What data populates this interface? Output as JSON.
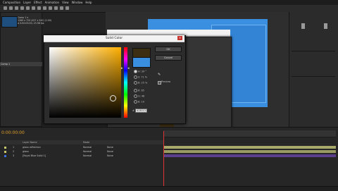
{
  "menu": [
    "Composition",
    "Layer",
    "Effect",
    "Animation",
    "View",
    "Window",
    "Help"
  ],
  "project": {
    "comp_name": "Comp 1 ▾",
    "info_line1": "1280 x 720  (427 x 240) (1.00)",
    "info_line2": "Δ 0:00:05:00, 23.98 fps",
    "comp_item": "Comp 1"
  },
  "dialog": {
    "title": "Solid Color",
    "close_glyph": "×",
    "ok_label": "OK",
    "cancel_label": "Cancel",
    "preview_label": "Preview",
    "fields": [
      {
        "label": "H:",
        "value": "39",
        "unit": "°"
      },
      {
        "label": "S:",
        "value": "71",
        "unit": "%"
      },
      {
        "label": "B:",
        "value": "25",
        "unit": "%"
      },
      {
        "label": "R:",
        "value": "65",
        "unit": ""
      },
      {
        "label": "G:",
        "value": "48",
        "unit": ""
      },
      {
        "label": "B:",
        "value": "19",
        "unit": ""
      }
    ],
    "hex_prefix": "#",
    "hex_value": "413013",
    "new_color": "#3b2e12",
    "old_color": "#3a8fe0"
  },
  "timeline": {
    "timecode": "0:00:00:00",
    "layer_header": "Layer Name",
    "mode_header": "Mode",
    "layers": [
      {
        "num": "1",
        "name": "glass reflection",
        "mode": "Normal",
        "trkmat": "None",
        "color": "#c8c86a"
      },
      {
        "num": "2",
        "name": "glass",
        "mode": "Normal",
        "trkmat": "None",
        "color": "#c8c86a"
      },
      {
        "num": "3",
        "name": "[Royal Blue Solid 1]",
        "mode": "Normal",
        "trkmat": "None",
        "color": "#3a6fe0"
      }
    ],
    "toggle_label": "Toggle Switches / Modes"
  },
  "colors": {
    "accent_blue": "#3a8fe0",
    "timecode_orange": "#e0a22a"
  }
}
